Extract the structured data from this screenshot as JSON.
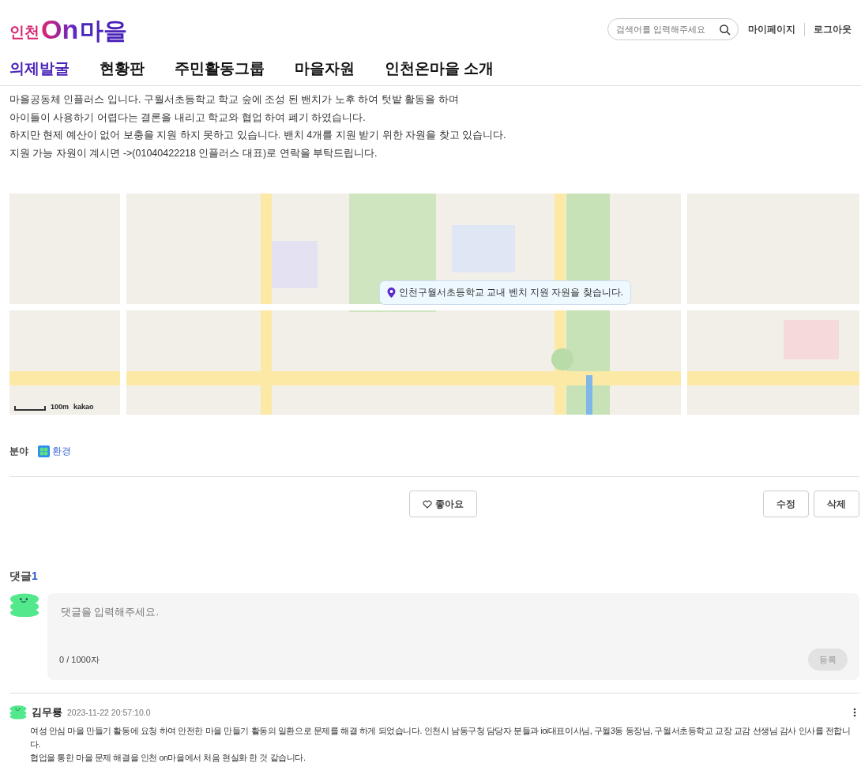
{
  "header": {
    "logo": {
      "region": "인천",
      "on": "On",
      "village": "마을"
    },
    "search": {
      "placeholder": "검색어를 입력해주세요"
    },
    "links": [
      "마이페이지",
      "로그아웃"
    ]
  },
  "nav": [
    {
      "label": "의제발굴",
      "selected": true
    },
    {
      "label": "현황판",
      "selected": false
    },
    {
      "label": "주민활동그룹",
      "selected": false
    },
    {
      "label": "마을자원",
      "selected": false
    },
    {
      "label": "인천온마을 소개",
      "selected": false
    }
  ],
  "body": [
    "마을공동체 인플러스 입니다. 구월서초등학교 학교 숲에 조성 된 밴치가 노후 하여 텃밭 활동을 하며",
    "아이들이 사용하기 어렵다는 결론을 내리고 학교와 협업 하여 폐기 하였습니다.",
    "하지만 현제 예산이 없어 보충을 지원 하지 못하고 있습니다. 밴치 4개를 지원 받기 위한 자원을 찾고 있습니다.",
    "지원 가능 자원이 계시면 ->(01040422218 인플러스 대표)로 연락을 부탁드립니다."
  ],
  "map": {
    "marker_label": "인천구월서초등학교 교내 벤치 지원 자원을 찾습니다.",
    "scale": "100m",
    "attribution": "kakao"
  },
  "field": {
    "label": "분야",
    "value": "환경"
  },
  "actions": {
    "like": "좋아요",
    "edit": "수정",
    "delete": "삭제"
  },
  "comments": {
    "title": "댓글",
    "count": "1",
    "input": {
      "placeholder": "댓글을 입력해주세요.",
      "counter": "0 / 1000자",
      "submit": "등록",
      "disabled": true
    },
    "items": [
      {
        "author": "김무룡",
        "date": "2023-11-22 20:57:10.0",
        "text": "여성 안심 마을 만들기 활동에 요청 하여 안전한 마을 만들기 활동의 일환으로 문제를 해결 하게 되었습니다. 인천시 남동구청 담당자 분들과 ioi대표이사님, 구월3동 동장님, 구월서초등학교 교장 교감 선생님 감사 인사를 전합니다.\n협업을 통한 마을 문제 해결을 인천 on마을에서 처음 현실화 한 것 같습니다."
      }
    ]
  }
}
